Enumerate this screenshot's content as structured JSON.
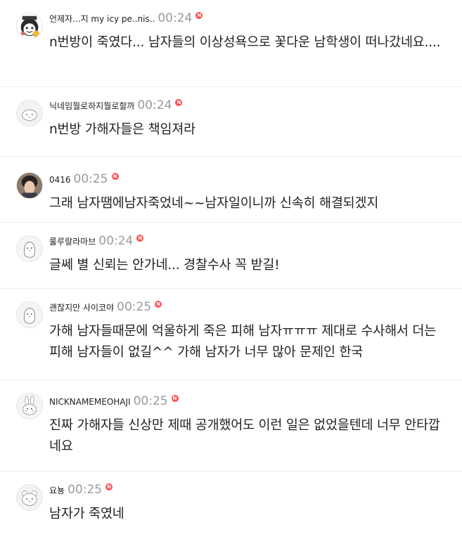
{
  "badge_text": "N",
  "comments": [
    {
      "nickname": "언제자...지 my icy pe..nis..",
      "time": "00:24",
      "avatar": "mascot-avatar",
      "text": "n번방이 죽였다... 남자들의 이상성욕으로 꽃다운 남학생이 떠나갔네요...."
    },
    {
      "nickname": "닉네임뭘로하지뭘로할까",
      "time": "00:24",
      "avatar": "blob-doodle-avatar",
      "text": "n번방 가해자들은 책임져라"
    },
    {
      "nickname": "0416",
      "time": "00:25",
      "avatar": "photo-avatar",
      "text": "그래 남자땜에남자죽었네~~남자일이니까 신속히 해결되겠지"
    },
    {
      "nickname": "룰루랄라마브",
      "time": "00:24",
      "avatar": "penguin-doodle-avatar",
      "text": "글쎄 별 신뢰는 안가네... 경찰수사 꼭 받길!"
    },
    {
      "nickname": "괜찮지만 사이코야",
      "time": "00:25",
      "avatar": "penguin-doodle-avatar",
      "text": "가해 남자들때문에 억울하게 죽은 피해 남자ㅠㅠㅠ 제대로 수사해서 더는 피해 남자들이 없길^^ 가해 남자가 너무 많아 문제인 한국"
    },
    {
      "nickname": "NICKNAMEMEOHAJI",
      "time": "00:25",
      "avatar": "bunny-doodle-avatar",
      "text": "진짜 가해자들 신상만 제때 공개했어도 이런 일은 없었을텐데 너무 안타깝네요"
    },
    {
      "nickname": "요뇽",
      "time": "00:25",
      "avatar": "bear-doodle-avatar",
      "text": "남자가 죽였네"
    }
  ]
}
